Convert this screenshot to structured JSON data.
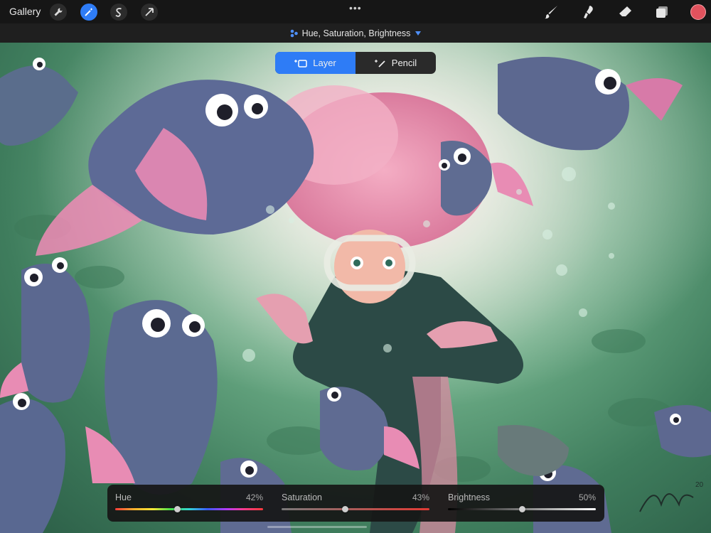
{
  "toolbar": {
    "gallery_label": "Gallery",
    "left_tools": [
      {
        "icon": "wrench-icon",
        "name": "actions"
      },
      {
        "icon": "magic-wand-icon",
        "name": "adjustments",
        "active": true
      },
      {
        "icon": "selection-s-icon",
        "name": "selection"
      },
      {
        "icon": "arrow-cursor-icon",
        "name": "transform"
      }
    ],
    "more_label": "•••",
    "right_tools": [
      {
        "icon": "brush-icon",
        "name": "brush"
      },
      {
        "icon": "smudge-icon",
        "name": "smudge"
      },
      {
        "icon": "eraser-icon",
        "name": "eraser"
      },
      {
        "icon": "layers-icon",
        "name": "layers"
      }
    ],
    "current_color": "#e0525d",
    "accent_color": "#2e7cf6"
  },
  "adjustment_bar": {
    "title": "Hue, Saturation, Brightness"
  },
  "mode_toggle": {
    "layer_label": "Layer",
    "pencil_label": "Pencil",
    "selected": "Layer"
  },
  "sliders": {
    "hue": {
      "label": "Hue",
      "value": "42%",
      "fraction": 0.42
    },
    "saturation": {
      "label": "Saturation",
      "value": "43%",
      "fraction": 0.43
    },
    "brightness": {
      "label": "Brightness",
      "value": "50%",
      "fraction": 0.5
    }
  }
}
